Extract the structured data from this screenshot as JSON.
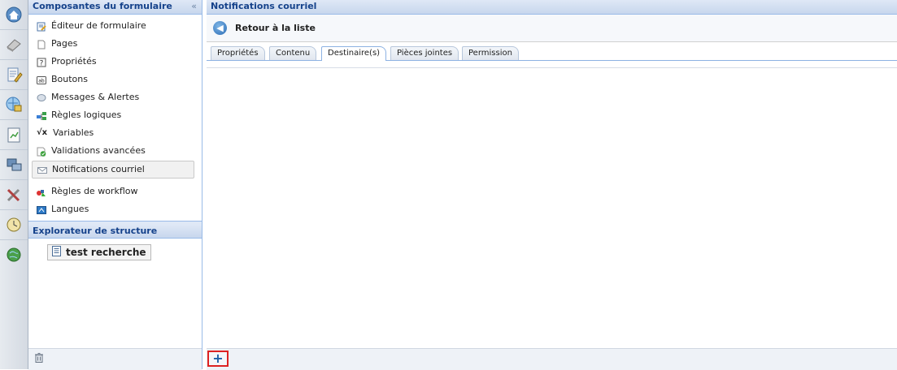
{
  "left_panel": {
    "title": "Composantes du formulaire",
    "collapse_glyph": "«",
    "items": [
      {
        "label": "Éditeur de formulaire",
        "icon": "form-editor-icon"
      },
      {
        "label": "Pages",
        "icon": "page-icon"
      },
      {
        "label": "Propriétés",
        "icon": "properties-icon"
      },
      {
        "label": "Boutons",
        "icon": "button-icon"
      },
      {
        "label": "Messages & Alertes",
        "icon": "message-icon"
      },
      {
        "label": "Règles logiques",
        "icon": "logic-rules-icon"
      },
      {
        "label": "Variables",
        "icon": "variables-icon"
      },
      {
        "label": "Validations avancées",
        "icon": "validation-icon"
      },
      {
        "label": "Notifications courriel",
        "icon": "email-icon"
      },
      {
        "label": "Règles de workflow",
        "icon": "workflow-icon"
      },
      {
        "label": "Langues",
        "icon": "languages-icon"
      }
    ],
    "selected_index": 8
  },
  "structure_panel": {
    "title": "Explorateur de structure",
    "node_label": "test recherche"
  },
  "main": {
    "title": "Notifications courriel",
    "back_label": "Retour à la liste",
    "tabs": [
      {
        "label": "Propriétés"
      },
      {
        "label": "Contenu"
      },
      {
        "label": "Destinaire(s)"
      },
      {
        "label": "Pièces jointes"
      },
      {
        "label": "Permission"
      }
    ],
    "active_tab_index": 2
  },
  "footer": {
    "add_glyph": "+",
    "variables_glyph": "√x"
  },
  "colors": {
    "header_text": "#15428b",
    "highlight_border": "#dd2222"
  }
}
